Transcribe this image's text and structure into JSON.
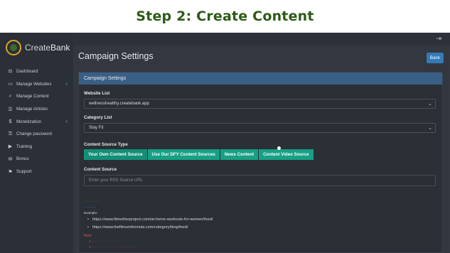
{
  "banner": {
    "title": "Step 2: Create Content"
  },
  "brand": {
    "name_part1": "Create",
    "name_part2": "Bank"
  },
  "sidebar": {
    "items": [
      {
        "label": "Dashboard",
        "icon": "dashboard-icon",
        "glyph": "◘",
        "has_children": false
      },
      {
        "label": "Manage Websites",
        "icon": "desktop-icon",
        "glyph": "▭",
        "has_children": true
      },
      {
        "label": "Manage Content",
        "icon": "search-icon",
        "glyph": "⌕",
        "has_children": false
      },
      {
        "label": "Manage Articles",
        "icon": "list-icon",
        "glyph": "☰",
        "has_children": false
      },
      {
        "label": "Monetization",
        "icon": "dollar-icon",
        "glyph": "$",
        "has_children": true
      },
      {
        "label": "Change password",
        "icon": "key-icon",
        "glyph": "⚿",
        "has_children": false
      },
      {
        "label": "Training",
        "icon": "video-icon",
        "glyph": "▶",
        "has_children": false
      },
      {
        "label": "Bonus",
        "icon": "gift-icon",
        "glyph": "✉",
        "has_children": false
      },
      {
        "label": "Support",
        "icon": "support-icon",
        "glyph": "⚑",
        "has_children": false
      }
    ]
  },
  "topbar": {
    "signout_glyph": "⇥"
  },
  "page": {
    "title": "Campaign Settings",
    "back_label": "Back"
  },
  "panel": {
    "heading": "Campaign Settings"
  },
  "form": {
    "website_label": "Website List",
    "website_value": "wellnesshealthy.createbank.app",
    "category_label": "Category List",
    "category_value": "Stay Fit",
    "source_type_label": "Content Source Type",
    "source_tabs": [
      {
        "label": "Your Own Content Source",
        "active": true
      },
      {
        "label": "Use Our DFY Content Sources",
        "active": false
      },
      {
        "label": "News Content",
        "active": false
      },
      {
        "label": "Content Video Source",
        "active": false
      }
    ],
    "source_label": "Content Source",
    "source_placeholder": "Enter your RSS Source URL",
    "examples_label": "Example:",
    "examples": [
      "https://www.fitmotherproject.com/at-home-workouts-for-women/feed/",
      "https://www.thefitmumformula.com/category/blog/feed/"
    ],
    "note_label": "Note:"
  },
  "colors": {
    "accent_teal": "#17a085",
    "panel_heading": "#3a5f86",
    "back_button": "#337ab7",
    "banner_green": "#2d5a16"
  }
}
